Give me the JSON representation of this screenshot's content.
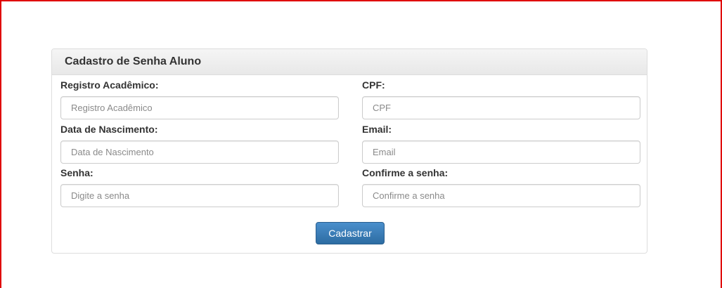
{
  "form": {
    "title": "Cadastro de Senha Aluno",
    "fields": [
      {
        "label": "Registro Acadêmico:",
        "placeholder": "Registro Acadêmico",
        "value": ""
      },
      {
        "label": "CPF:",
        "placeholder": "CPF",
        "value": ""
      },
      {
        "label": "Data de Nascimento:",
        "placeholder": "Data de Nascimento",
        "value": ""
      },
      {
        "label": "Email:",
        "placeholder": "Email",
        "value": ""
      },
      {
        "label": "Senha:",
        "placeholder": "Digite a senha",
        "value": ""
      },
      {
        "label": "Confirme a senha:",
        "placeholder": "Confirme a senha",
        "value": ""
      }
    ],
    "submit_label": "Cadastrar"
  },
  "colors": {
    "frame_border": "#e00000",
    "button_primary": "#337ab7",
    "panel_heading_bg": "#f5f5f5"
  }
}
